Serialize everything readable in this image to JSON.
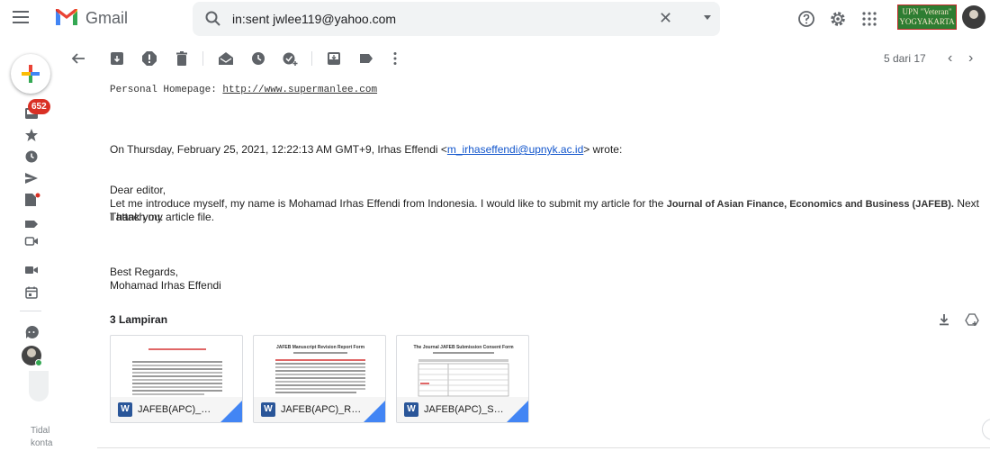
{
  "app": {
    "brand": "Gmail"
  },
  "search": {
    "query": "in:sent jwlee119@yahoo.com",
    "clear": "✕"
  },
  "org_badge": {
    "line1": "UPN \"Veteran\"",
    "line2": "YOGYAKARTA"
  },
  "sidebar": {
    "unread_count": "652",
    "status_text_line1": "Tidal",
    "status_text_line2": "konta"
  },
  "pager": {
    "position": "5 dari 17",
    "prev": "‹",
    "next": "›"
  },
  "email": {
    "homepage_label": "Personal Homepage: ",
    "homepage_link": "http://www.supermanlee.com",
    "quote_prefix": "On Thursday, February 25, 2021, 12:22:13 AM GMT+9, Irhas Effendi <",
    "quote_email": "m_irhaseffendi@upnyk.ac.id",
    "quote_suffix": "> wrote:",
    "greeting": "Dear editor,",
    "body_pre": "Let me introduce myself, my name is Mohamad Irhas Effendi from Indonesia. I would like to submit my article for the ",
    "journal": "Journal of Asian Finance, Economics and Business (JAFEB).",
    "body_post": " Next I attach my article file.",
    "thanks": "Thank you.",
    "closing": "Best Regards,",
    "signature": "Mohamad Irhas Effendi"
  },
  "attachments": {
    "title": "3 Lampiran",
    "items": [
      {
        "name": "JAFEB(APC)_Manu...",
        "type_icon": "W",
        "doc_title": ""
      },
      {
        "name": "JAFEB(APC)_Revis...",
        "type_icon": "W",
        "doc_title": "JAFEB Manuscript Revision Report Form"
      },
      {
        "name": "JAFEB(APC)_Subm...",
        "type_icon": "W",
        "doc_title": "The Journal JAFEB Submission Consent Form"
      }
    ]
  },
  "colors": {
    "accent_red": "#d93025",
    "link": "#1155cc",
    "word_blue": "#2a5699",
    "org_green": "#2e7d32"
  }
}
